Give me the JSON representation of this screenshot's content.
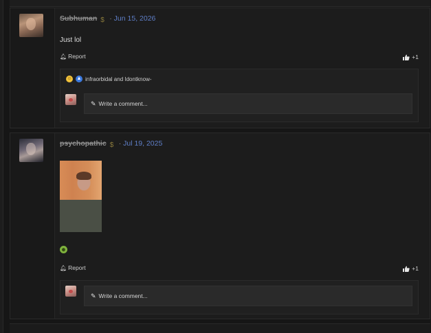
{
  "colors": {
    "background": "#161616",
    "post_background": "#1c1c1c",
    "date_link": "#5f7fc8",
    "username": "#8e8e8e"
  },
  "posts": [
    {
      "username": "Subhuman",
      "separator": "·",
      "date": "Jun 15, 2026",
      "body": "Just lol",
      "report_label": "Report",
      "like_count": "+1",
      "reactions_text": "infraorbidal and Idontknow-",
      "comment_placeholder": "Write a comment..."
    },
    {
      "username": "psychopathic",
      "separator": "·",
      "date": "Jul 19, 2025",
      "report_label": "Report",
      "like_count": "+1",
      "comment_placeholder": "Write a comment..."
    }
  ]
}
